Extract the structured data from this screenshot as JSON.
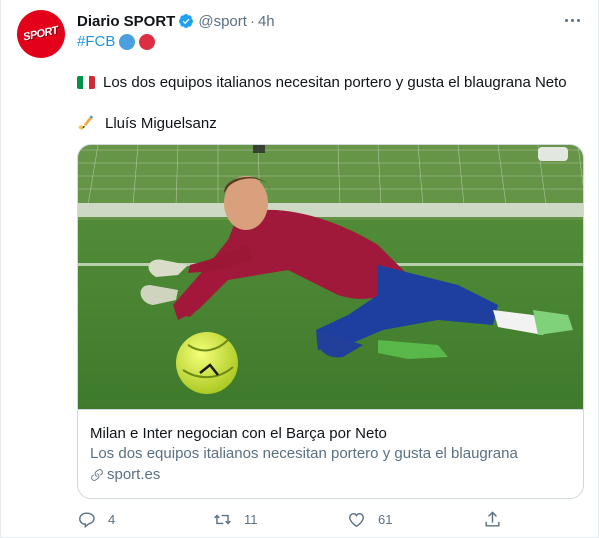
{
  "account": {
    "name": "Diario SPORT",
    "handle": "@sport",
    "separator": "·",
    "time": "4h",
    "avatar_text": "SPORT"
  },
  "hashtag": "#FCB",
  "hashtag_emoji_colors": [
    "#4a9fe0",
    "#dd2e44"
  ],
  "body": {
    "line1_flag": "italy-flag",
    "line1": "Los dos equipos italianos necesitan portero y gusta el blaugrana Neto",
    "line2_icon": "writing-hand-icon",
    "line2": "Lluís Miguelsanz"
  },
  "card": {
    "title": "Milan e Inter negocian con el Barça por Neto",
    "description": "Los dos equipos italianos necesitan portero y gusta el blaugrana",
    "domain": "sport.es"
  },
  "actions": {
    "replies": "4",
    "retweets": "11",
    "likes": "61"
  },
  "colors": {
    "accent": "#1b95e0",
    "brand_red": "#e2001a",
    "secondary_text": "#5b7083",
    "border": "#cfd9de"
  }
}
